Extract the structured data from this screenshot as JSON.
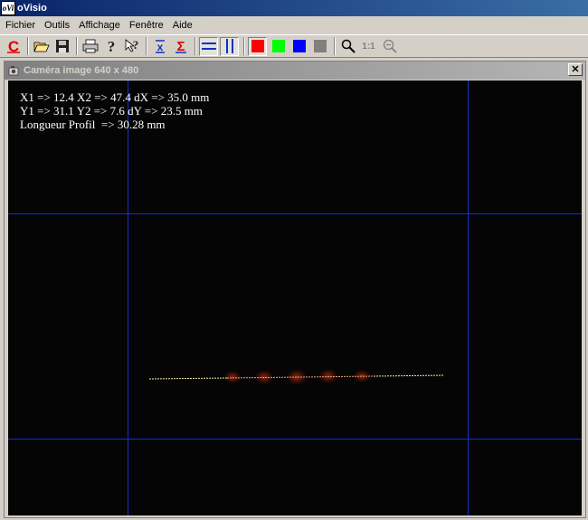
{
  "app": {
    "title": "oVisio",
    "icon_text": "oVi"
  },
  "menu": [
    "Fichier",
    "Outils",
    "Affichage",
    "Fenêtre",
    "Aide"
  ],
  "toolbar": {
    "icons": [
      "calibrate-c-icon",
      "open-folder-icon",
      "save-disk-icon",
      "print-icon",
      "help-icon",
      "context-help-icon",
      "sigma-x-icon",
      "sigma-icon",
      "horizontal-lines-icon",
      "vertical-lines-icon",
      "red-channel-icon",
      "green-channel-icon",
      "blue-channel-icon",
      "gray-channel-icon",
      "zoom-icon",
      "zoom-1to1-icon",
      "zoom-out-icon"
    ],
    "zoom_1to1_label": "1:1",
    "colors": {
      "red": "#ff0000",
      "green": "#00ff00",
      "blue": "#0000ff",
      "gray": "#808080"
    }
  },
  "image_window": {
    "title": "Caméra image 640 x 480",
    "close_label": "✕",
    "readout": {
      "line1": "X1 => 12.4 X2 => 47.4 dX => 35.0 mm",
      "line2": "Y1 => 31.1 Y2 => 7.6 dY => 23.5 mm",
      "line3": "Longueur Profil  => 30.28 mm"
    },
    "grid_color": "#1a2ad0",
    "profile_color": "#f5e9a0"
  }
}
